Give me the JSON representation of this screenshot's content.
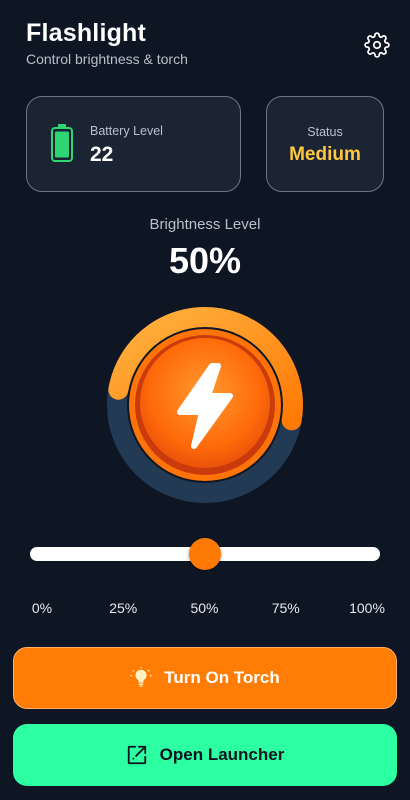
{
  "header": {
    "title": "Flashlight",
    "subtitle": "Control brightness & torch",
    "settings_icon": "gear-icon"
  },
  "battery_card": {
    "label": "Battery Level",
    "value": "22",
    "icon": "battery-icon",
    "icon_color": "#2ed573"
  },
  "status_card": {
    "label": "Status",
    "value": "Medium",
    "value_color": "#ffc640"
  },
  "brightness": {
    "label": "Brightness Level",
    "value_text": "50%",
    "level_fraction": 0.5,
    "center_icon": "lightning-bolt-icon"
  },
  "slider": {
    "value_fraction": 0.5,
    "ticks": [
      "0%",
      "25%",
      "50%",
      "75%",
      "100%"
    ]
  },
  "buttons": {
    "torch": {
      "label": "Turn On Torch",
      "icon": "lightbulb-icon",
      "color": "#ff7d04"
    },
    "launcher": {
      "label": "Open Launcher",
      "icon": "external-link-icon",
      "color": "#2dffa3"
    }
  },
  "colors": {
    "background": "#0e1624",
    "accent": "#ff7a05",
    "card": "#1a2433"
  }
}
